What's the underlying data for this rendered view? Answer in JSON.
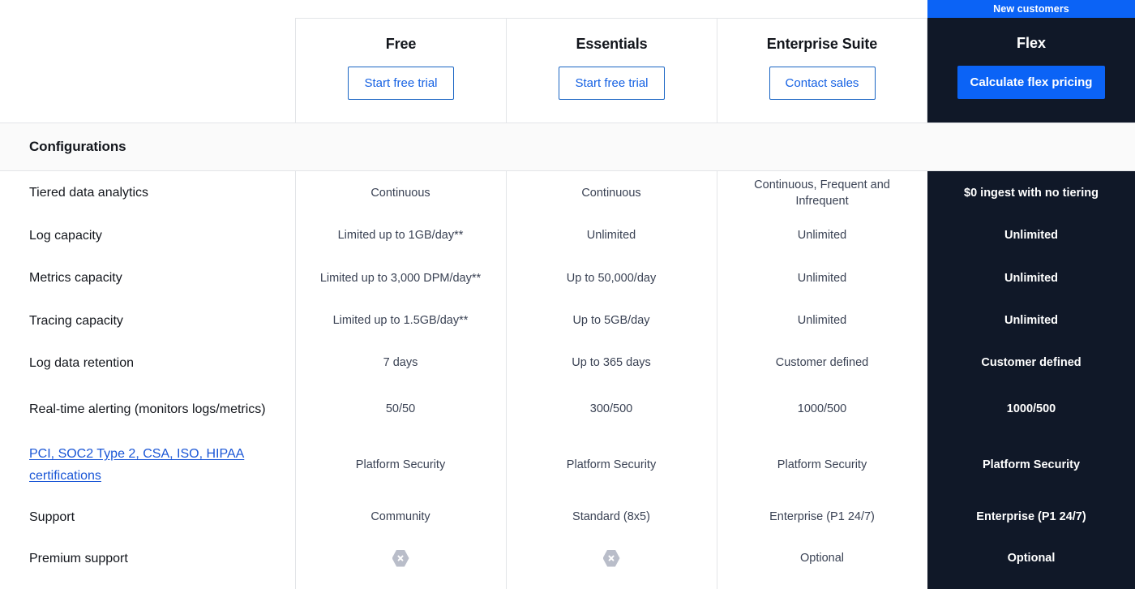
{
  "colors": {
    "accent_blue": "#0b63f6",
    "link_blue": "#1a56d6",
    "cta_blue": "#1561e3",
    "flex_dark": "#101828",
    "section_band": "#fafafa",
    "border": "#e3e5e8"
  },
  "header": {
    "plans": [
      {
        "name": "Free",
        "cta": "Start free trial",
        "ribbon": null,
        "highlighted": false
      },
      {
        "name": "Essentials",
        "cta": "Start free trial",
        "ribbon": null,
        "highlighted": false
      },
      {
        "name": "Enterprise Suite",
        "cta": "Contact sales",
        "ribbon": null,
        "highlighted": false
      },
      {
        "name": "Flex",
        "cta": "Calculate flex pricing",
        "ribbon": "New customers",
        "highlighted": true
      }
    ]
  },
  "section": {
    "title": "Configurations"
  },
  "table": {
    "columns": [
      "Free",
      "Essentials",
      "Enterprise Suite",
      "Flex"
    ],
    "rows": [
      {
        "label": "Tiered data analytics",
        "label_is_link": false,
        "free": "Continuous",
        "essentials": "Continuous",
        "enterprise": "Continuous, Frequent and Infrequent",
        "flex": "$0 ingest with no tiering"
      },
      {
        "label": "Log capacity",
        "label_is_link": false,
        "free": "Limited up to 1GB/day**",
        "essentials": "Unlimited",
        "enterprise": "Unlimited",
        "flex": "Unlimited"
      },
      {
        "label": "Metrics capacity",
        "label_is_link": false,
        "free": "Limited up to 3,000 DPM/day**",
        "essentials": "Up to 50,000/day",
        "enterprise": "Unlimited",
        "flex": "Unlimited"
      },
      {
        "label": "Tracing capacity",
        "label_is_link": false,
        "free": "Limited up to 1.5GB/day**",
        "essentials": "Up to 5GB/day",
        "enterprise": "Unlimited",
        "flex": "Unlimited"
      },
      {
        "label": "Log data retention",
        "label_is_link": false,
        "free": "7 days",
        "essentials": "Up to 365 days",
        "enterprise": "Customer defined",
        "flex": "Customer defined"
      },
      {
        "label": "Real-time alerting (monitors logs/metrics)",
        "label_is_link": false,
        "free": "50/50",
        "essentials": "300/500",
        "enterprise": "1000/500",
        "flex": "1000/500"
      },
      {
        "label": "PCI, SOC2 Type 2, CSA, ISO, HIPAA certifications",
        "label_is_link": true,
        "free": "Platform Security",
        "essentials": "Platform Security",
        "enterprise": "Platform Security",
        "flex": "Platform Security"
      },
      {
        "label": "Support",
        "label_is_link": false,
        "free": "Community",
        "essentials": "Standard (8x5)",
        "enterprise": "Enterprise (P1 24/7)",
        "flex": "Enterprise (P1 24/7)"
      },
      {
        "label": "Premium support",
        "label_is_link": false,
        "free": "not-included-icon",
        "essentials": "not-included-icon",
        "enterprise": "Optional",
        "flex": "Optional"
      }
    ]
  }
}
